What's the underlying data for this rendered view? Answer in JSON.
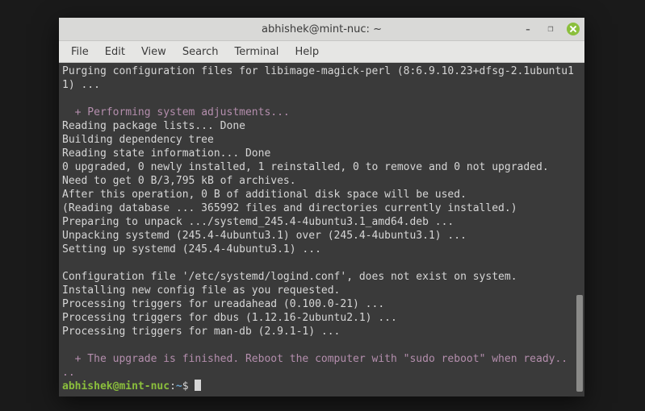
{
  "window": {
    "title": "abhishek@mint-nuc: ~"
  },
  "menu": {
    "items": [
      "File",
      "Edit",
      "View",
      "Search",
      "Terminal",
      "Help"
    ]
  },
  "terminal": {
    "line_purge": "Purging configuration files for libimage-magick-perl (8:6.9.10.23+dfsg-2.1ubuntu11) ...",
    "line_adjust_head": "  + Performing system adjustments...",
    "lines_block1": [
      "Reading package lists... Done",
      "Building dependency tree",
      "Reading state information... Done",
      "0 upgraded, 0 newly installed, 1 reinstalled, 0 to remove and 0 not upgraded.",
      "Need to get 0 B/3,795 kB of archives.",
      "After this operation, 0 B of additional disk space will be used.",
      "(Reading database ... 365992 files and directories currently installed.)",
      "Preparing to unpack .../systemd_245.4-4ubuntu3.1_amd64.deb ...",
      "Unpacking systemd (245.4-4ubuntu3.1) over (245.4-4ubuntu3.1) ...",
      "Setting up systemd (245.4-4ubuntu3.1) ..."
    ],
    "lines_block2": [
      "Configuration file '/etc/systemd/logind.conf', does not exist on system.",
      "Installing new config file as you requested.",
      "Processing triggers for ureadahead (0.100.0-21) ...",
      "Processing triggers for dbus (1.12.16-2ubuntu2.1) ...",
      "Processing triggers for man-db (2.9.1-1) ..."
    ],
    "line_finish": "  + The upgrade is finished. Reboot the computer with \"sudo reboot\" when ready..",
    "dots": "..",
    "prompt_user_host": "abhishek@mint-nuc",
    "prompt_sep": ":",
    "prompt_path": "~",
    "prompt_dollar": "$ "
  }
}
